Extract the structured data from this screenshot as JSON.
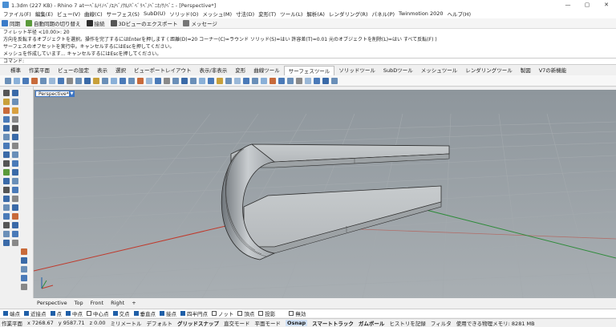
{
  "window": {
    "title": "1.3dm (227 KB) - Rhino 7 at一ﾍﾞﾙ/ｲﾉﾍﾞ/ｴ/ﾍﾞ/ｸﾙ/ﾊﾞﾍﾞﾘﾍﾞ/ﾍﾞﾆﾎ/ｸ/ﾍﾞﾆ - [Perspective*]",
    "minimize": "—",
    "maximize": "▢",
    "close": "✕"
  },
  "menu": [
    "ファイル(F)",
    "編集(E)",
    "ビュー(V)",
    "曲線(C)",
    "サーフェス(S)",
    "SubD(U)",
    "ソリッド(O)",
    "メッシュ(M)",
    "寸法(D)",
    "変形(T)",
    "ツール(L)",
    "解析(A)",
    "レンダリング(R)",
    "パネル(P)",
    "Twinmotion 2020",
    "ヘルプ(H)"
  ],
  "toolbar1": [
    {
      "label": "同期",
      "icon": "sync-icon"
    },
    {
      "label": "自動同期の切り替え",
      "icon": "auto-sync-icon"
    },
    {
      "label": "接続",
      "icon": "connect-icon"
    },
    {
      "label": "3Dビューのエクスポート",
      "icon": "export-3d-icon"
    },
    {
      "label": "メッセージ",
      "icon": "message-icon"
    }
  ],
  "history": [
    "フィレット半径 <10.00>: 20",
    "方向を反転するオブジェクトを選択。操作を完了するにはEnterを押します ( 距離(D)=20  コーナー(C)=ラウンド  ソリッド(S)=はい  許容差(T)=0.01  元のオブジェクトを削除(L)=はい  すべて反転(F) )",
    "サーフェスのオフセットを実行中。キャンセルするにはEscを押してください。",
    "メッシュを作成しています... キャンセルするにはEscを押してください。"
  ],
  "command_prompt": "コマンド:",
  "tabs": [
    "標準",
    "作業平面",
    "ビューの設定",
    "表示",
    "選択",
    "ビューポートレイアウト",
    "表示/非表示",
    "変形",
    "曲線ツール",
    "サーフェスツール",
    "ソリッドツール",
    "SubDツール",
    "メッシュツール",
    "レンダリングツール",
    "製図",
    "V7の新機能"
  ],
  "active_tab": "サーフェスツール",
  "viewport": {
    "label": "Perspective*",
    "axis_colors": {
      "x": "#c0392b",
      "y": "#2e8b3a"
    }
  },
  "viewport_tabs": [
    "Perspective",
    "Top",
    "Front",
    "Right",
    "+"
  ],
  "osnap": [
    {
      "label": "端点",
      "checked": true
    },
    {
      "label": "近接点",
      "checked": true
    },
    {
      "label": "点",
      "checked": true
    },
    {
      "label": "中点",
      "checked": true
    },
    {
      "label": "中心点",
      "checked": false
    },
    {
      "label": "交点",
      "checked": true
    },
    {
      "label": "垂直点",
      "checked": true
    },
    {
      "label": "接点",
      "checked": true
    },
    {
      "label": "四半円点",
      "checked": true
    },
    {
      "label": "ノット",
      "checked": false
    },
    {
      "label": "頂点",
      "checked": false
    },
    {
      "label": "投影",
      "checked": false
    },
    {
      "label": "無効",
      "checked": false
    }
  ],
  "status": {
    "plane": "作業平面",
    "x": "x 7268.67",
    "y": "y 9587.71",
    "z": "z 0.00",
    "unit": "ミリメートル",
    "layer": "デフォルト",
    "grid_snap": "グリッドスナップ",
    "ortho": "直交モード",
    "planar": "平面モード",
    "osnap": "Osnap",
    "smarttrack": "スマートトラック",
    "gumball": "ガムボール",
    "history": "ヒストリを記録",
    "filter": "フィルタ",
    "memory": "使用できる物理メモリ: 8281 MB"
  }
}
